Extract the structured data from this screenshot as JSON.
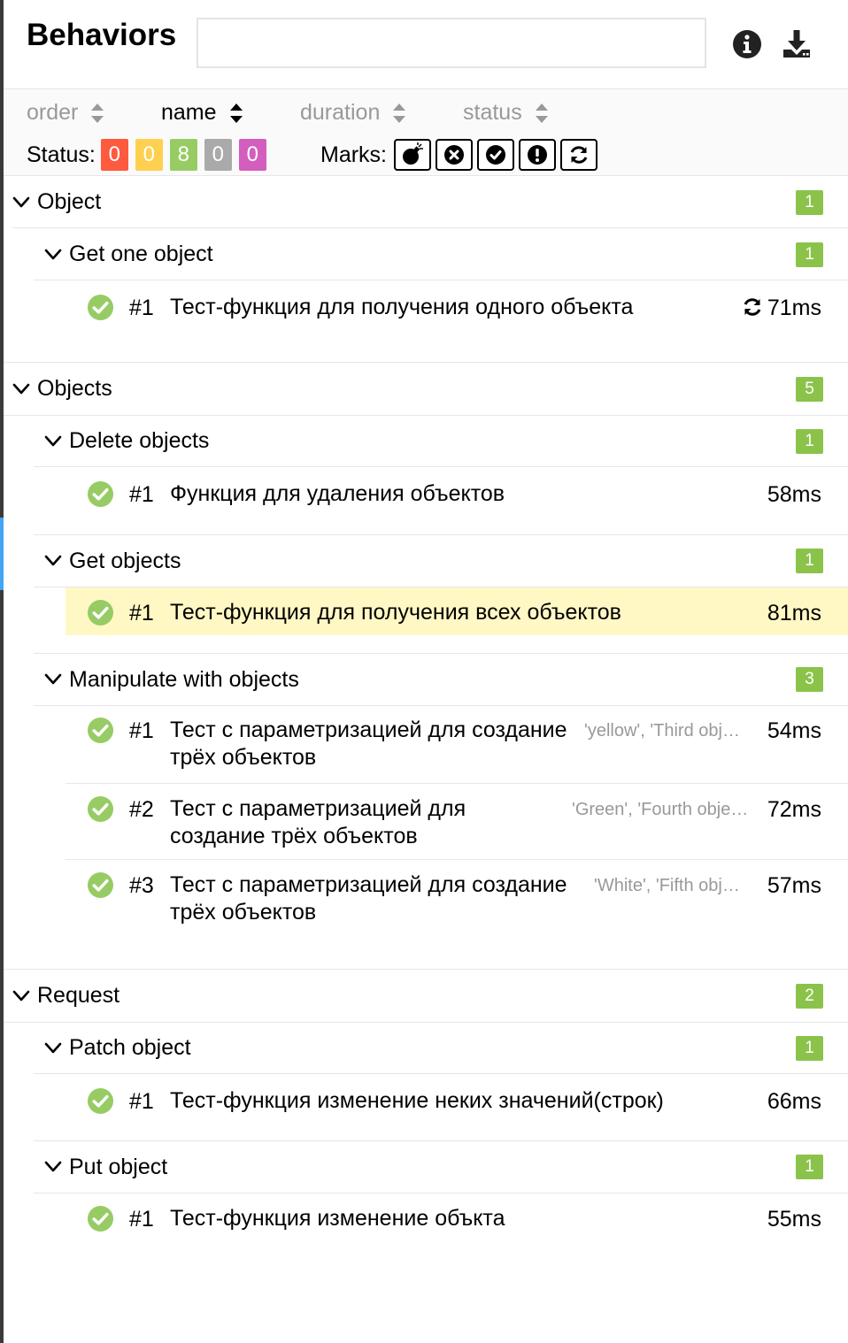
{
  "header": {
    "title": "Behaviors",
    "search_value": "",
    "search_placeholder": ""
  },
  "icons": {
    "info": "info-circle-icon",
    "download": "download-icon"
  },
  "sorts": [
    {
      "label": "order",
      "active": false
    },
    {
      "label": "name",
      "active": true
    },
    {
      "label": "duration",
      "active": false
    },
    {
      "label": "status",
      "active": false
    }
  ],
  "status_filter": {
    "label": "Status:",
    "badges": [
      {
        "value": "0",
        "color": "#fd5a3e"
      },
      {
        "value": "0",
        "color": "#ffd050"
      },
      {
        "value": "8",
        "color": "#97cc64"
      },
      {
        "value": "0",
        "color": "#aaaaaa"
      },
      {
        "value": "0",
        "color": "#d35ebe"
      }
    ]
  },
  "marks": {
    "label": "Marks:",
    "items": [
      "bomb-icon",
      "times-circle-icon",
      "check-circle-icon",
      "exclamation-circle-icon",
      "refresh-icon"
    ]
  },
  "colors": {
    "passed": "#97cc64",
    "count_badge": "#8bc34a",
    "highlight": "#fff8c4",
    "accent_bar": "#42a5f5"
  },
  "groups": [
    {
      "name": "Object",
      "count": "1",
      "features": [
        {
          "name": "Get one object",
          "count": "1",
          "tests": [
            {
              "num": "#1",
              "name": "Тест-функция для получения одного объекта",
              "params": "",
              "duration": "71ms",
              "retry": true
            }
          ]
        }
      ]
    },
    {
      "name": "Objects",
      "count": "5",
      "features": [
        {
          "name": "Delete objects",
          "count": "1",
          "tests": [
            {
              "num": "#1",
              "name": "Функция для удаления объектов",
              "params": "",
              "duration": "58ms"
            }
          ]
        },
        {
          "name": "Get objects",
          "count": "1",
          "tests": [
            {
              "num": "#1",
              "name": "Тест-функция для получения всех объектов",
              "params": "",
              "duration": "81ms",
              "selected": true
            }
          ]
        },
        {
          "name": "Manipulate with objects",
          "count": "3",
          "tests": [
            {
              "num": "#1",
              "name_l1": "Тест с параметризацией для создание",
              "name_l2": "трёх объектов",
              "params": "'yellow', 'Third obj…",
              "duration": "54ms"
            },
            {
              "num": "#2",
              "name_l1": "Тест с параметризацией для",
              "name_l2": "создание трёх объектов",
              "params": "'Green', 'Fourth obje…",
              "duration": "72ms"
            },
            {
              "num": "#3",
              "name_l1": "Тест с параметризацией для создание",
              "name_l2": "трёх объектов",
              "params": "'White', 'Fifth obj…",
              "duration": "57ms"
            }
          ]
        }
      ]
    },
    {
      "name": "Request",
      "count": "2",
      "features": [
        {
          "name": "Patch object",
          "count": "1",
          "tests": [
            {
              "num": "#1",
              "name": "Тест-функция изменение неких значений(строк)",
              "params": "",
              "duration": "66ms"
            }
          ]
        },
        {
          "name": "Put object",
          "count": "1",
          "tests": [
            {
              "num": "#1",
              "name": "Тест-функция изменение объкта",
              "params": "",
              "duration": "55ms"
            }
          ]
        }
      ]
    }
  ]
}
